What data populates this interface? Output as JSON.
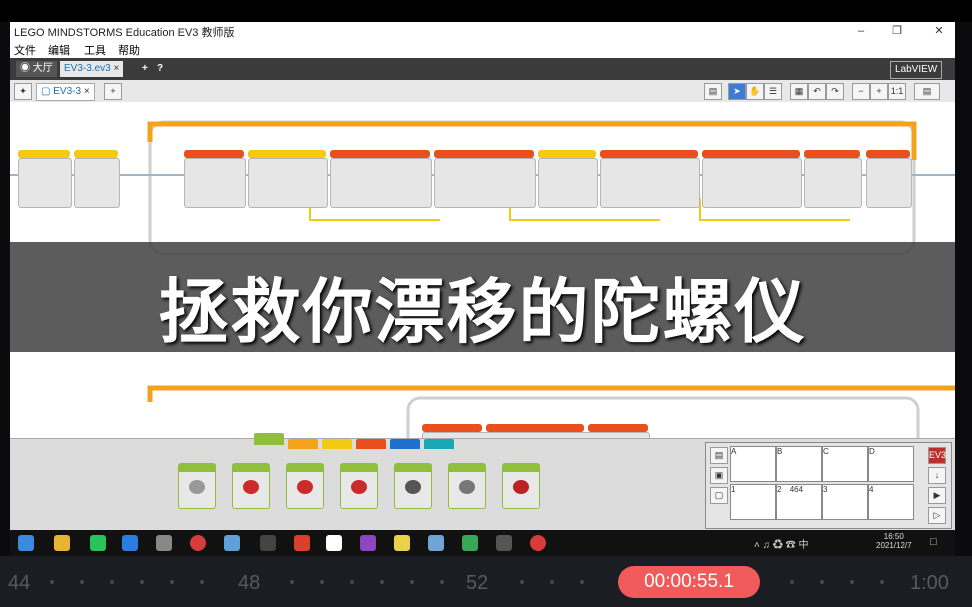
{
  "window": {
    "title": "LEGO MINDSTORMS Education EV3 教师版"
  },
  "menu": [
    "文件",
    "编辑",
    "工具",
    "帮助"
  ],
  "tabs": {
    "lobby": "大厅",
    "project": "EV3-3.ev3",
    "program": "EV3-3",
    "labview": "LabVIEW"
  },
  "caption": "拯救你漂移的陀螺仪",
  "ports": {
    "top": [
      "A",
      "B",
      "C",
      "D"
    ],
    "bottom": [
      "1",
      "2",
      "3",
      "4"
    ],
    "sensor_value": "464"
  },
  "taskbar": {
    "time": "16:50",
    "date": "2021/12/7"
  },
  "timeline": {
    "labels": [
      "44",
      "48",
      "52",
      "1:00"
    ],
    "current": "00:00:55.1"
  },
  "colors": {
    "accent_orange": "#e94f1d",
    "accent_yellow": "#f3c911",
    "timeline_pill": "#f05a5a"
  }
}
